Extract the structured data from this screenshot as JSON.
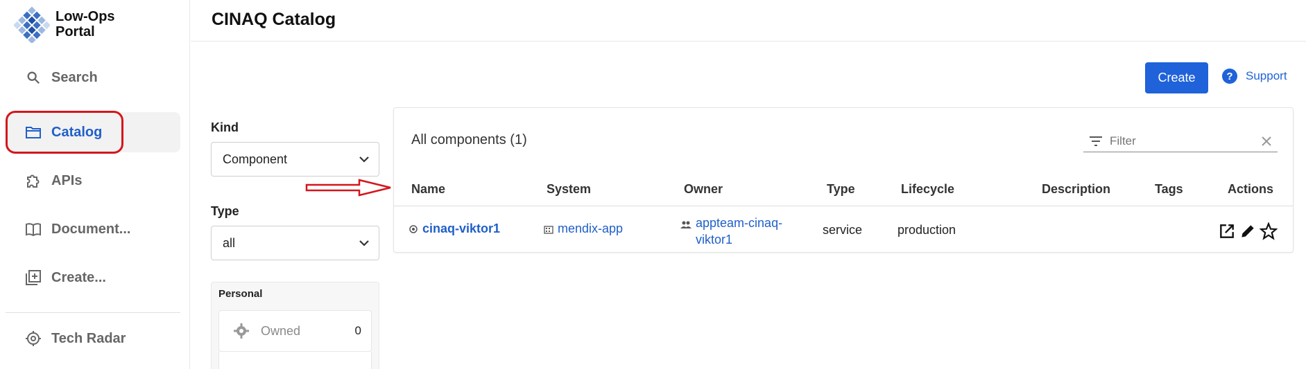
{
  "app": {
    "name_line1": "Low-Ops",
    "name_line2": "Portal"
  },
  "sidebar": {
    "items": [
      {
        "label": "Search",
        "icon": "search-icon"
      },
      {
        "label": "Catalog",
        "icon": "folder-icon",
        "active": true
      },
      {
        "label": "APIs",
        "icon": "puzzle-icon"
      },
      {
        "label": "Document...",
        "icon": "book-icon"
      },
      {
        "label": "Create...",
        "icon": "add-box-icon"
      },
      {
        "label": "Tech Radar",
        "icon": "radar-icon"
      }
    ]
  },
  "header": {
    "title": "CINAQ Catalog"
  },
  "toolbar": {
    "create_label": "Create",
    "support_label": "Support"
  },
  "filters": {
    "kind_label": "Kind",
    "kind_value": "Component",
    "type_label": "Type",
    "type_value": "all",
    "personal_title": "Personal",
    "owned_label": "Owned",
    "owned_count": "0"
  },
  "table": {
    "title": "All components (1)",
    "filter_placeholder": "Filter",
    "columns": [
      "Name",
      "System",
      "Owner",
      "Type",
      "Lifecycle",
      "Description",
      "Tags",
      "Actions"
    ],
    "rows": [
      {
        "name": "cinaq-viktor1",
        "system": "mendix-app",
        "owner_line1": "appteam-cinaq-",
        "owner_line2": "viktor1",
        "type": "service",
        "lifecycle": "production",
        "description": "",
        "tags": ""
      }
    ]
  },
  "colors": {
    "accent": "#1f62d9",
    "annotation": "#d4161c",
    "active_bg": "#f2f2f2"
  }
}
